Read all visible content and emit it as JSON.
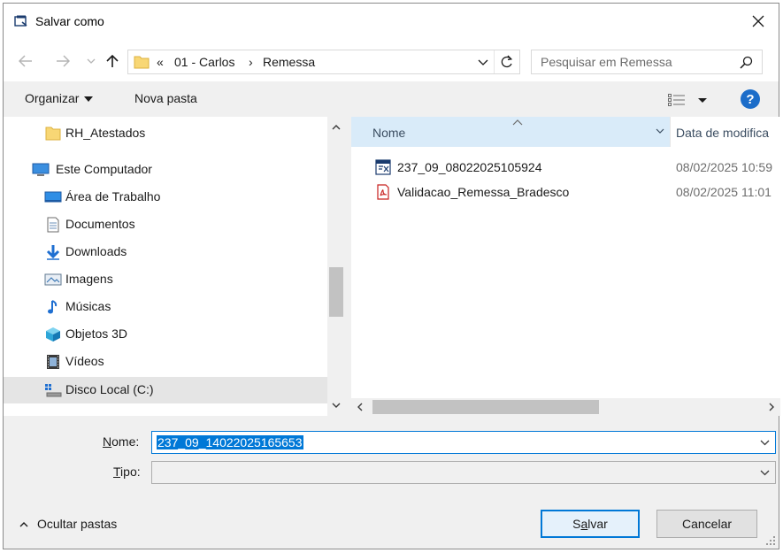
{
  "window": {
    "title": "Salvar como",
    "close_icon": "close-icon"
  },
  "nav": {
    "back_icon": "back-arrow-icon",
    "forward_icon": "forward-arrow-icon",
    "recent_icon": "recent-locations-chevron-icon",
    "up_icon": "up-arrow-icon"
  },
  "address": {
    "overflow": "«",
    "crumbs": [
      "01 - Carlos",
      "Remessa"
    ],
    "separator": "›"
  },
  "search": {
    "placeholder": "Pesquisar em Remessa"
  },
  "toolbar": {
    "organize_label": "Organizar",
    "new_folder_label": "Nova pasta",
    "help_label": "?"
  },
  "sidebar": {
    "items": [
      {
        "label": "RH_Atestados",
        "icon": "folder-icon"
      },
      {
        "label": "Este Computador",
        "icon": "computer-icon"
      },
      {
        "label": "Área de Trabalho",
        "icon": "desktop-icon"
      },
      {
        "label": "Documentos",
        "icon": "documents-icon"
      },
      {
        "label": "Downloads",
        "icon": "downloads-icon"
      },
      {
        "label": "Imagens",
        "icon": "pictures-icon"
      },
      {
        "label": "Músicas",
        "icon": "music-icon"
      },
      {
        "label": "Objetos 3D",
        "icon": "3d-objects-icon"
      },
      {
        "label": "Vídeos",
        "icon": "videos-icon"
      },
      {
        "label": "Disco Local (C:)",
        "icon": "local-disk-icon",
        "selected": true
      }
    ]
  },
  "files": {
    "columns": {
      "name": "Nome",
      "date": "Data de modifica"
    },
    "rows": [
      {
        "name": "237_09_08022025105924",
        "date": "08/02/2025 10:59",
        "icon": "remessa-file-icon"
      },
      {
        "name": "Validacao_Remessa_Bradesco",
        "date": "08/02/2025 11:01",
        "icon": "pdf-icon"
      }
    ]
  },
  "form": {
    "name_label_underlined": "N",
    "name_label_rest": "ome:",
    "name_value": "237_09_14022025165653",
    "type_label_underlined": "T",
    "type_label_rest": "ipo:",
    "type_value": ""
  },
  "footer": {
    "toggle_folders_label": "Ocultar pastas",
    "save_label_pre": "S",
    "save_label_underlined": "a",
    "save_label_post": "lvar",
    "cancel_label": "Cancelar"
  },
  "colors": {
    "accent": "#0078d7",
    "header_highlight": "#d9ebf9",
    "selected_bg": "#e5e5e5",
    "help_blue": "#1c6dc9"
  }
}
